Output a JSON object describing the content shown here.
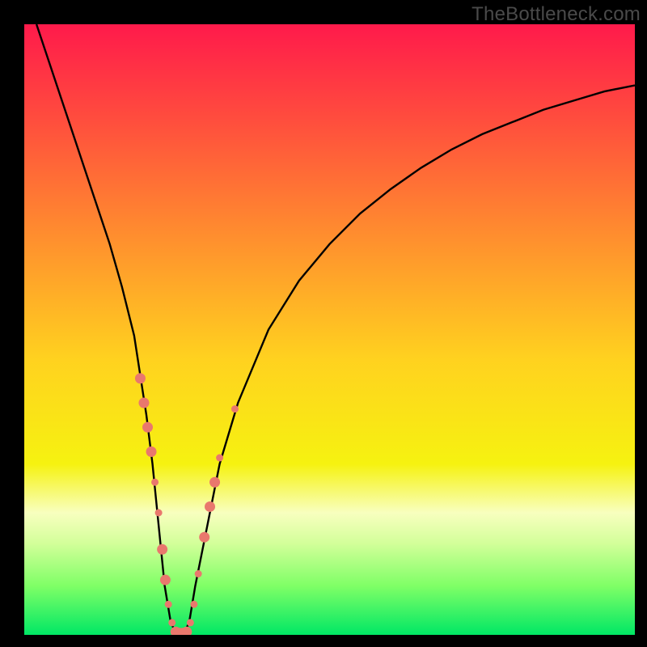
{
  "watermark": "TheBottleneck.com",
  "chart_data": {
    "type": "line",
    "title": "",
    "xlabel": "",
    "ylabel": "",
    "xlim": [
      0,
      100
    ],
    "ylim": [
      0,
      100
    ],
    "grid": false,
    "legend": false,
    "background_gradient_stops": [
      {
        "offset": 0.0,
        "color": "#ff1a4b"
      },
      {
        "offset": 0.15,
        "color": "#ff4b3e"
      },
      {
        "offset": 0.35,
        "color": "#ff8f2e"
      },
      {
        "offset": 0.55,
        "color": "#ffd21f"
      },
      {
        "offset": 0.72,
        "color": "#f6f210"
      },
      {
        "offset": 0.8,
        "color": "#f8ffbf"
      },
      {
        "offset": 0.85,
        "color": "#d3ff9a"
      },
      {
        "offset": 0.92,
        "color": "#7fff66"
      },
      {
        "offset": 1.0,
        "color": "#00e765"
      }
    ],
    "series": [
      {
        "name": "bottleneck-curve",
        "color": "#000000",
        "x": [
          2,
          4,
          6,
          8,
          10,
          12,
          14,
          16,
          18,
          20,
          21,
          22,
          23,
          24,
          25,
          26,
          27,
          28,
          30,
          32,
          35,
          40,
          45,
          50,
          55,
          60,
          65,
          70,
          75,
          80,
          85,
          90,
          95,
          100
        ],
        "y": [
          100,
          94,
          88,
          82,
          76,
          70,
          64,
          57,
          49,
          36,
          28,
          18,
          8,
          2,
          0,
          0,
          2,
          8,
          18,
          28,
          38,
          50,
          58,
          64,
          69,
          73,
          76.5,
          79.5,
          82,
          84,
          86,
          87.5,
          89,
          90
        ]
      }
    ],
    "markers": {
      "name": "highlight-dots",
      "color": "#e9786d",
      "radius_small": 4.5,
      "radius_large": 6.5,
      "points": [
        {
          "x": 19.0,
          "y": 42,
          "r": "large"
        },
        {
          "x": 19.6,
          "y": 38,
          "r": "large"
        },
        {
          "x": 20.2,
          "y": 34,
          "r": "large"
        },
        {
          "x": 20.8,
          "y": 30,
          "r": "large"
        },
        {
          "x": 21.4,
          "y": 25,
          "r": "small"
        },
        {
          "x": 22.0,
          "y": 20,
          "r": "small"
        },
        {
          "x": 22.6,
          "y": 14,
          "r": "large"
        },
        {
          "x": 23.1,
          "y": 9,
          "r": "large"
        },
        {
          "x": 23.6,
          "y": 5,
          "r": "small"
        },
        {
          "x": 24.2,
          "y": 2,
          "r": "small"
        },
        {
          "x": 24.8,
          "y": 0.5,
          "r": "large"
        },
        {
          "x": 25.4,
          "y": 0.3,
          "r": "large"
        },
        {
          "x": 26.0,
          "y": 0.3,
          "r": "large"
        },
        {
          "x": 26.6,
          "y": 0.5,
          "r": "large"
        },
        {
          "x": 27.2,
          "y": 2,
          "r": "small"
        },
        {
          "x": 27.8,
          "y": 5,
          "r": "small"
        },
        {
          "x": 28.5,
          "y": 10,
          "r": "small"
        },
        {
          "x": 29.5,
          "y": 16,
          "r": "large"
        },
        {
          "x": 30.4,
          "y": 21,
          "r": "large"
        },
        {
          "x": 31.2,
          "y": 25,
          "r": "large"
        },
        {
          "x": 32.0,
          "y": 29,
          "r": "small"
        },
        {
          "x": 34.5,
          "y": 37,
          "r": "small"
        }
      ]
    }
  }
}
